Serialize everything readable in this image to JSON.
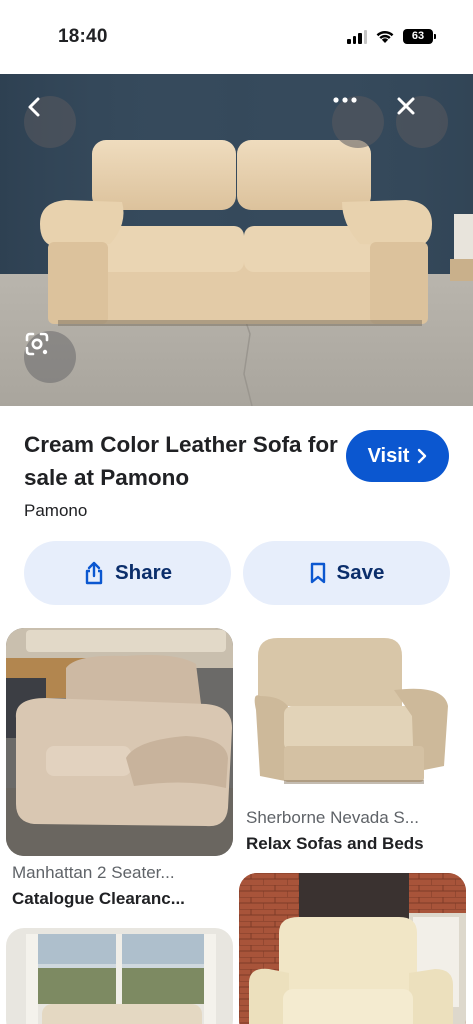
{
  "status_bar": {
    "time": "18:40",
    "battery": "63"
  },
  "product": {
    "title": "Cream Color Leather Sofa for sale at Pamono",
    "source": "Pamono",
    "visit_label": "Visit"
  },
  "actions": {
    "share_label": "Share",
    "save_label": "Save"
  },
  "results": [
    {
      "caption": "Manhattan 2 Seater...",
      "source": "Catalogue Clearanc..."
    },
    {
      "caption": "Sherborne Nevada S...",
      "source": "Relax Sofas and Beds"
    }
  ],
  "colors": {
    "accent": "#0b57d0",
    "pill_bg": "#e7eefb",
    "pill_text": "#0b2e6b"
  },
  "icons": [
    "back-icon",
    "more-icon",
    "close-icon",
    "lens-icon",
    "share-icon",
    "bookmark-icon",
    "chevron-right-icon"
  ]
}
